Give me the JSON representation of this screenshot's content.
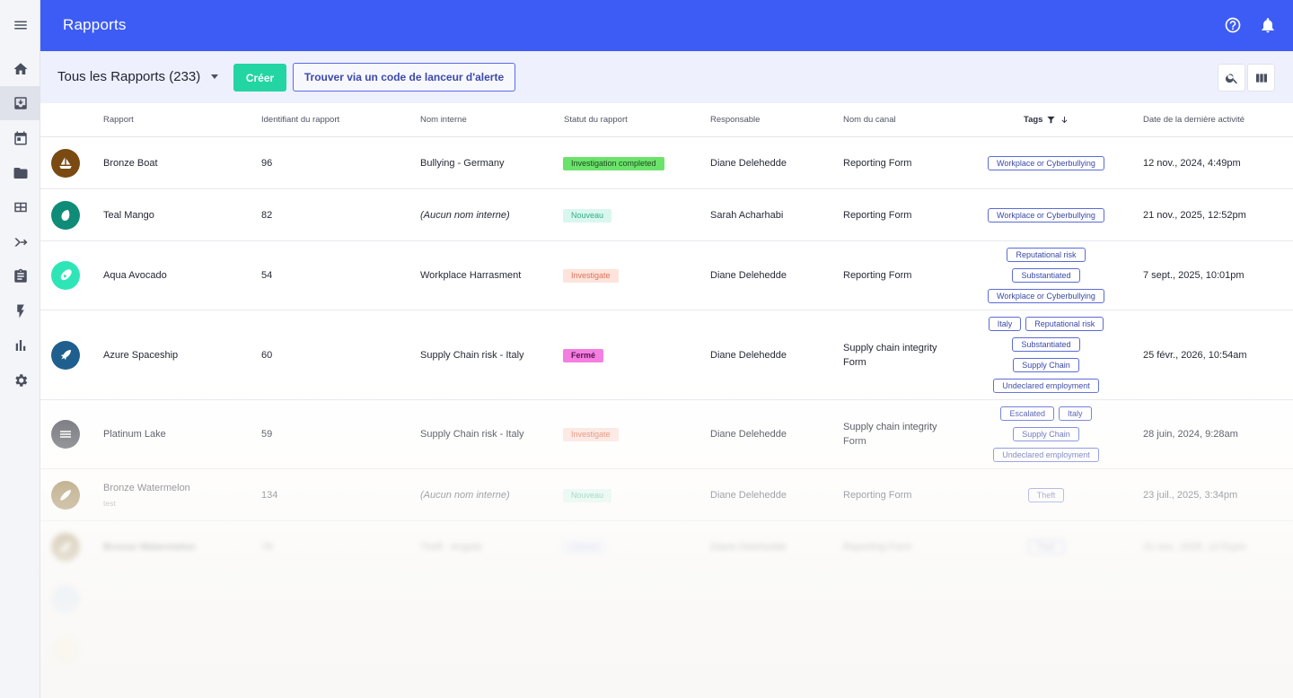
{
  "header": {
    "title": "Rapports"
  },
  "sidebar": {
    "items": [
      {
        "icon": "menu-icon"
      },
      {
        "icon": "home-icon"
      },
      {
        "icon": "inbox-icon"
      },
      {
        "icon": "calendar-icon"
      },
      {
        "icon": "folder-icon"
      },
      {
        "icon": "table-icon"
      },
      {
        "icon": "merge-icon"
      },
      {
        "icon": "clipboard-icon"
      },
      {
        "icon": "flash-icon"
      },
      {
        "icon": "bar-chart-icon"
      },
      {
        "icon": "settings-icon"
      }
    ]
  },
  "toolbar": {
    "view_label": "Tous les Rapports (233)",
    "create_label": "Créer",
    "find_label": "Trouver via un code de lanceur d'alerte"
  },
  "table": {
    "columns": {
      "rapport": "Rapport",
      "identifiant": "Identifiant du rapport",
      "nom_interne": "Nom interne",
      "statut": "Statut du rapport",
      "responsable": "Responsable",
      "canal": "Nom du canal",
      "tags": "Tags",
      "date": "Date de la dernière activité"
    },
    "rows": [
      {
        "name": "Bronze Boat",
        "sub": "",
        "id": "96",
        "internal": "Bullying - Germany",
        "status": "Investigation completed",
        "owner": "Diane Delehedde",
        "channel": "Reporting Form",
        "tags": [
          "Workplace or Cyberbullying"
        ],
        "date": "12 nov., 2024, 4:49pm"
      },
      {
        "name": "Teal Mango",
        "sub": "",
        "id": "82",
        "internal": "(Aucun nom interne)",
        "status": "Nouveau",
        "owner": "Sarah Acharhabi",
        "channel": "Reporting Form",
        "tags": [
          "Workplace or Cyberbullying"
        ],
        "date": "21 nov., 2025, 12:52pm"
      },
      {
        "name": "Aqua Avocado",
        "sub": "",
        "id": "54",
        "internal": "Workplace Harrasment",
        "status": "Investigate",
        "owner": "Diane Delehedde",
        "channel": "Reporting Form",
        "tags": [
          "Reputational risk",
          "Substantiated",
          "Workplace or Cyberbullying"
        ],
        "date": "7 sept., 2025, 10:01pm"
      },
      {
        "name": "Azure Spaceship",
        "sub": "",
        "id": "60",
        "internal": "Supply Chain risk - Italy",
        "status": "Fermé",
        "owner": "Diane Delehedde",
        "channel": "Supply chain integrity Form",
        "tags": [
          "Italy",
          "Reputational risk",
          "Substantiated",
          "Supply Chain",
          "Undeclared employment"
        ],
        "date": "25 févr., 2026, 10:54am"
      },
      {
        "name": "Platinum Lake",
        "sub": "",
        "id": "59",
        "internal": "Supply Chain risk - Italy",
        "status": "Investigate",
        "owner": "Diane Delehedde",
        "channel": "Supply chain integrity Form",
        "tags": [
          "Escalated",
          "Italy",
          "Supply Chain",
          "Undeclared employment"
        ],
        "date": "28 juin, 2024, 9:28am"
      },
      {
        "name": "Bronze Watermelon",
        "sub": "test",
        "id": "134",
        "internal": "(Aucun nom interne)",
        "status": "Nouveau",
        "owner": "Diane Delehedde",
        "channel": "Reporting Form",
        "tags": [
          "Theft"
        ],
        "date": "23 juil., 2025, 3:34pm"
      },
      {
        "name": "Bronze Watermelon",
        "sub": "",
        "id": "78",
        "internal": "Theft - Angola",
        "status": "Clôturé",
        "owner": "Diane Delehedde",
        "channel": "Reporting Form",
        "tags": [
          "Theft"
        ],
        "date": "21 nov., 2025, 12:51pm"
      }
    ]
  },
  "colors": {
    "brand": "#3d5cf5",
    "create": "#23d5a2",
    "status_completed": "#6be36b",
    "status_new": "#d9f7ee",
    "status_investigate": "#fde3dc",
    "status_closed": "#f47fe0"
  }
}
